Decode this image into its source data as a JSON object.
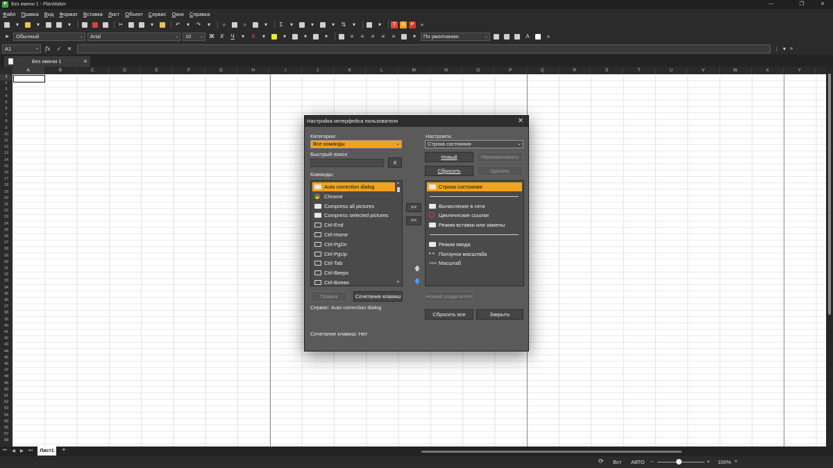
{
  "window": {
    "title": "Без имени 1 - PlanMaker",
    "app_glyph": "P",
    "controls": [
      "—",
      "❐",
      "✕"
    ]
  },
  "menu": [
    {
      "label": "Файл",
      "ul": "Ф",
      "rest": "айл"
    },
    {
      "label": "Правка",
      "ul": "П",
      "rest": "равка"
    },
    {
      "label": "Вид",
      "ul": "В",
      "rest": "ид"
    },
    {
      "label": "Формат",
      "ul": "Ф",
      "rest": "ормат"
    },
    {
      "label": "Вставка",
      "ul": "В",
      "rest": "ставка"
    },
    {
      "label": "Лист",
      "ul": "Л",
      "rest": "ист"
    },
    {
      "label": "Объект",
      "ul": "О",
      "rest": "бъект"
    },
    {
      "label": "Сервис",
      "ul": "С",
      "rest": "ервис"
    },
    {
      "label": "Окно",
      "ul": "О",
      "rest": "кно"
    },
    {
      "label": "Справка",
      "ul": "С",
      "rest": "правка"
    }
  ],
  "toolbar": {
    "badges": [
      {
        "text": "T",
        "color": "#e04a3a"
      },
      {
        "text": "S",
        "color": "#f0a020"
      },
      {
        "text": "P",
        "color": "#d83a2a"
      }
    ],
    "style_value": "Обычный",
    "font_value": "Arial",
    "size_value": "10",
    "bold": "Ж",
    "italic": "К",
    "underline": "Ч",
    "align_value": "По умолчанию",
    "overflow": "»"
  },
  "formula": {
    "cell_ref": "A1",
    "fx": "fx",
    "check": "✓",
    "cancel": "✕"
  },
  "doc_tab": {
    "label": "Без имени 1",
    "close": "✕"
  },
  "columns": [
    "A",
    "B",
    "C",
    "D",
    "E",
    "F",
    "G",
    "H",
    "I",
    "J",
    "K",
    "L",
    "M",
    "N",
    "O",
    "P",
    "Q",
    "R",
    "S",
    "T",
    "U",
    "V",
    "W",
    "X",
    "Y"
  ],
  "rows": [
    "1",
    "2",
    "3",
    "4",
    "5",
    "6",
    "7",
    "8",
    "9",
    "10",
    "11",
    "12",
    "13",
    "14",
    "15",
    "16",
    "17",
    "18",
    "19",
    "20",
    "21",
    "22",
    "23",
    "24",
    "25",
    "26",
    "27",
    "28",
    "29",
    "30",
    "31",
    "32",
    "33",
    "34",
    "35",
    "36",
    "37",
    "38",
    "39",
    "40",
    "41",
    "42",
    "43",
    "44",
    "45",
    "46",
    "47",
    "48",
    "49",
    "50",
    "51",
    "52",
    "53",
    "54",
    "55",
    "56",
    "57",
    "58"
  ],
  "sheet": {
    "tab_label": "Лист1",
    "add": "+"
  },
  "status": {
    "mode_ins": "Вст",
    "mode_auto": "АВТО",
    "zoom": "100%",
    "zoom_minus": "−",
    "zoom_plus": "+",
    "zoom_level": 0.45
  },
  "dialog": {
    "title": "Настройка интерфейса пользователя",
    "category_label": "Категории:",
    "category_value": "Все команды",
    "quicksearch_label": "Быстрый поиск:",
    "quicksearch_value": "",
    "clear_label": "X",
    "commands_label": "Команды:",
    "commands": [
      {
        "label": "Auto correction dialog",
        "icon": "abc-icon",
        "selected": true
      },
      {
        "label": "Chrome",
        "icon": "chrome-icon"
      },
      {
        "label": "Compress all pictures",
        "icon": "picture-icon"
      },
      {
        "label": "Compress selected pictures",
        "icon": "picture-icon"
      },
      {
        "label": "Ctrl-End",
        "icon": "keyboard-icon"
      },
      {
        "label": "Ctrl-Home",
        "icon": "keyboard-icon"
      },
      {
        "label": "Ctrl-PgDn",
        "icon": "keyboard-icon"
      },
      {
        "label": "Ctrl-PgUp",
        "icon": "keyboard-icon"
      },
      {
        "label": "Ctrl-Tab",
        "icon": "keyboard-icon"
      },
      {
        "label": "Ctrl-Вверх",
        "icon": "keyboard-icon"
      },
      {
        "label": "Ctrl-Влево",
        "icon": "keyboard-icon"
      }
    ],
    "add_arrow": ">>",
    "remove_arrow": "<<",
    "edit_button": "Правка",
    "shortcut_button": "Сочетания клавиш",
    "service_line": "Сервис: Auto correction dialog",
    "shortcut_line": "Сочетание клавиш: Нет",
    "configure_label": "Настроить:",
    "configure_value": "Строка состояния",
    "new_button": "Новый",
    "rename_button": "Переименовать",
    "reset_button": "Сбросить",
    "delete_button": "Удалить",
    "items": [
      {
        "label": "Строка состояния",
        "icon": "statusbar-icon",
        "selected": true
      },
      {
        "separator": true
      },
      {
        "label": "Вычисление в сети",
        "icon": "statusbar-icon"
      },
      {
        "label": "Циклические ссылки",
        "icon": "circular-icon"
      },
      {
        "label": "Режим вставки или замены",
        "icon": "statusbar-icon"
      },
      {
        "separator": true
      },
      {
        "label": "Режим ввода",
        "icon": "statusbar-icon"
      },
      {
        "label": "Ползунок масштаба",
        "icon": "slider-icon"
      },
      {
        "label": "Масштаб",
        "icon": "percent-icon"
      }
    ],
    "new_separator_button": "Новый разделитель",
    "reset_all_button": "Сбросить все",
    "close_button": "Закрыть"
  }
}
